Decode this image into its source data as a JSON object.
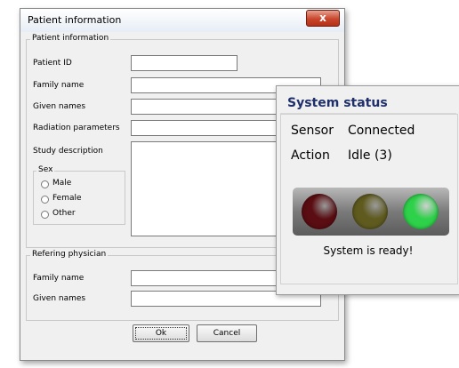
{
  "dialog": {
    "title": "Patient information",
    "close_glyph": "x",
    "patient_group": {
      "legend": "Patient information",
      "fields": [
        {
          "label": "Patient ID",
          "value": ""
        },
        {
          "label": "Family name",
          "value": ""
        },
        {
          "label": "Given names",
          "value": ""
        },
        {
          "label": "Radiation parameters",
          "value": ""
        },
        {
          "label": "Study description",
          "value": ""
        }
      ],
      "sex": {
        "legend": "Sex",
        "options": [
          "Male",
          "Female",
          "Other"
        ]
      }
    },
    "physician_group": {
      "legend": "Refering physician",
      "fields": [
        {
          "label": "Family name",
          "value": ""
        },
        {
          "label": "Given names",
          "value": ""
        }
      ]
    },
    "buttons": {
      "ok": "Ok",
      "cancel": "Cancel"
    }
  },
  "status": {
    "title": "System status",
    "rows": [
      {
        "label": "Sensor",
        "value": "Connected"
      },
      {
        "label": "Action",
        "value": "Idle (3)"
      }
    ],
    "lights": {
      "red": "#5a0d12",
      "yellow": "#5f5a1e",
      "green": "#2ed14a",
      "active": "green"
    },
    "message": "System is ready!"
  }
}
